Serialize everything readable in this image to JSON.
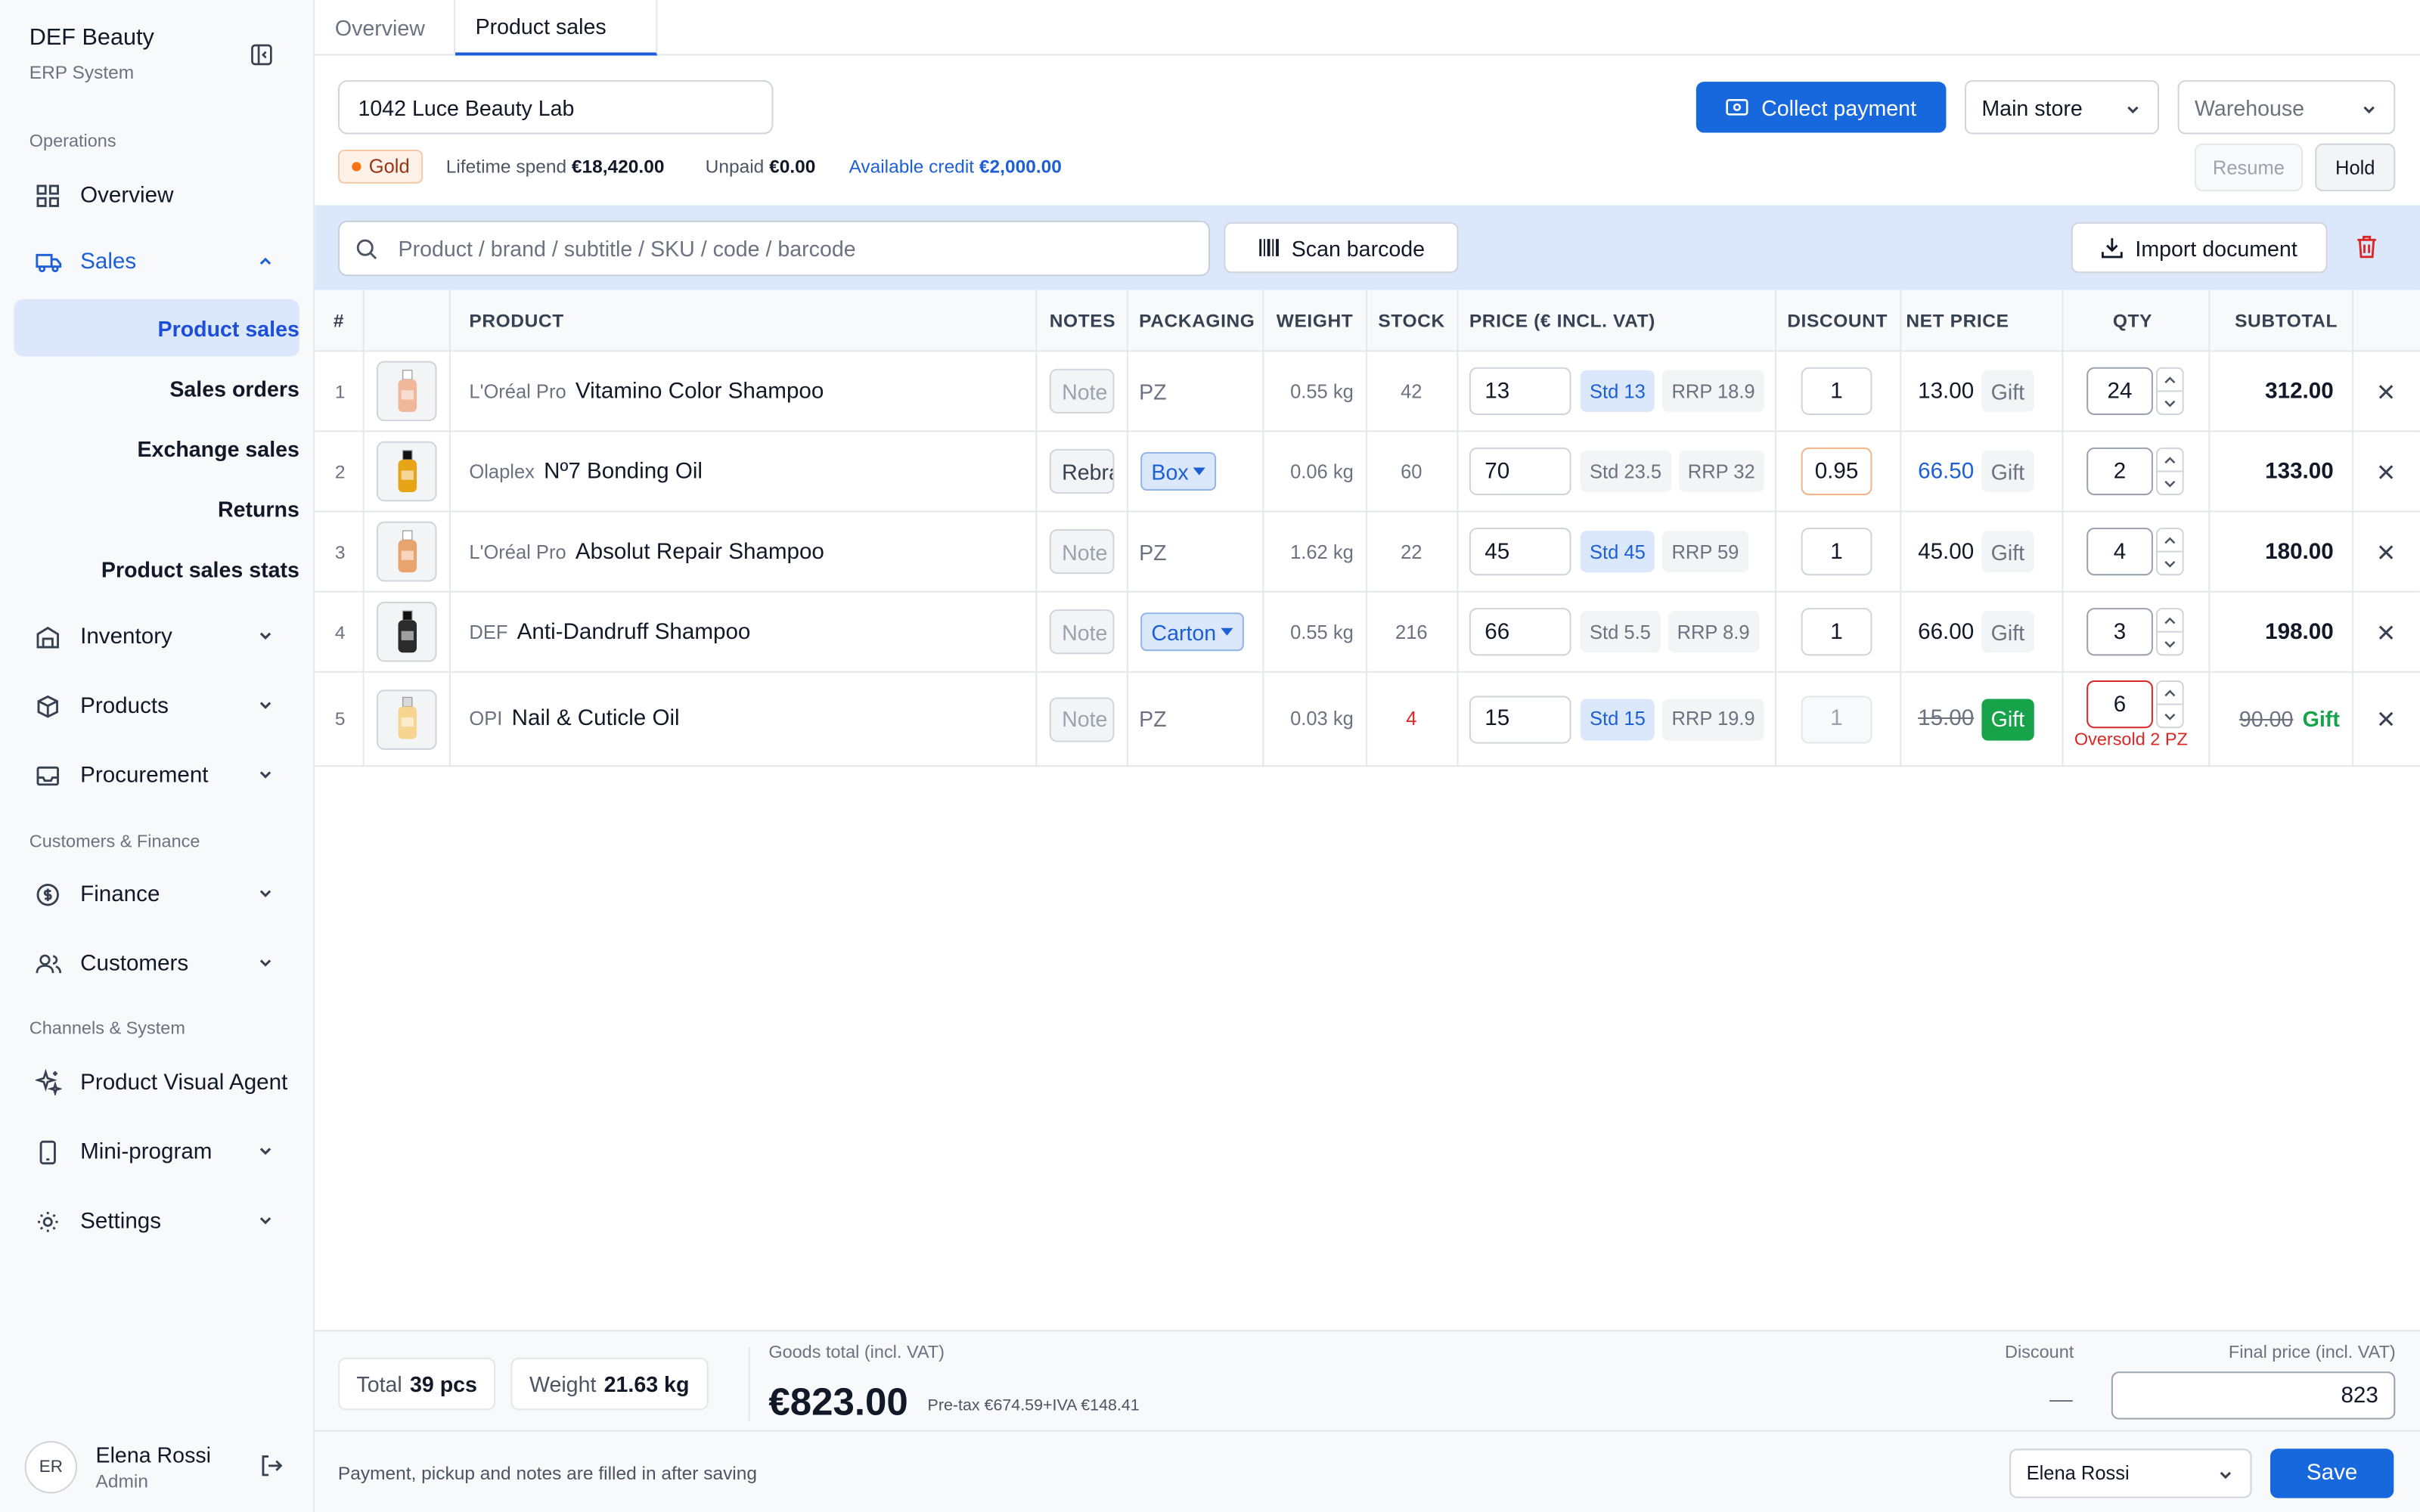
{
  "brand": {
    "title": "DEF Beauty",
    "subtitle": "ERP System"
  },
  "sidebar": {
    "sec_operations": "Operations",
    "overview": "Overview",
    "sales": "Sales",
    "sales_sub": [
      "Product sales",
      "Sales orders",
      "Exchange sales",
      "Returns",
      "Product sales stats"
    ],
    "inventory": "Inventory",
    "products": "Products",
    "procurement": "Procurement",
    "sec_customers": "Customers & Finance",
    "finance": "Finance",
    "customers": "Customers",
    "sec_channels": "Channels & System",
    "visual_agent": "Product Visual Agent",
    "mini_program": "Mini-program",
    "settings": "Settings"
  },
  "user": {
    "initials": "ER",
    "name": "Elena Rossi",
    "role": "Admin"
  },
  "tabs": [
    "Overview",
    "Product sales"
  ],
  "header": {
    "customer": "1042 Luce Beauty Lab",
    "collect_payment": "Collect payment",
    "store": "Main store",
    "warehouse_placeholder": "Warehouse",
    "resume": "Resume",
    "hold": "Hold",
    "tier": "Gold",
    "lifetime_label": "Lifetime spend",
    "lifetime_value": "€18,420.00",
    "unpaid_label": "Unpaid",
    "unpaid_value": "€0.00",
    "credit_label": "Available credit",
    "credit_value": "€2,000.00"
  },
  "toolbar": {
    "search_placeholder": "Product / brand / subtitle / SKU / code / barcode",
    "scan": "Scan barcode",
    "import": "Import document"
  },
  "columns": [
    "#",
    "PRODUCT",
    "NOTES",
    "PACKAGING",
    "WEIGHT",
    "STOCK",
    "PRICE (€ INCL. VAT)",
    "DISCOUNT",
    "NET PRICE",
    "QTY",
    "SUBTOTAL"
  ],
  "rows": [
    {
      "n": "1",
      "brand": "L'Oréal Pro",
      "name": "Vitamino Color Shampoo",
      "note": "Note",
      "note_filled": false,
      "pkg": "PZ",
      "pkg_sel": false,
      "weight": "0.55 kg",
      "stock": "42",
      "stock_low": false,
      "price": "13",
      "std": "Std 13",
      "std_on": true,
      "rrp": "RRP 18.9",
      "discount": "1",
      "disc_state": "normal",
      "net": "13.00",
      "net_state": "normal",
      "gift": "Gift",
      "gift_on": false,
      "qty": "24",
      "qty_err": false,
      "oversold": "",
      "subtotal": "312.00",
      "sub_strike": false,
      "bottle": "#f0b79a",
      "cap": "#ffffff"
    },
    {
      "n": "2",
      "brand": "Olaplex",
      "name": "Nº7 Bonding Oil",
      "note": "Rebrand",
      "note_filled": true,
      "pkg": "Box",
      "pkg_sel": true,
      "weight": "0.06 kg",
      "stock": "60",
      "stock_low": false,
      "price": "70",
      "std": "Std 23.5",
      "std_on": false,
      "rrp": "RRP 32",
      "discount": "0.95",
      "disc_state": "warn",
      "net": "66.50",
      "net_state": "blue",
      "gift": "Gift",
      "gift_on": false,
      "qty": "2",
      "qty_err": false,
      "oversold": "",
      "subtotal": "133.00",
      "sub_strike": false,
      "bottle": "#e8a417",
      "cap": "#111111"
    },
    {
      "n": "3",
      "brand": "L'Oréal Pro",
      "name": "Absolut Repair Shampoo",
      "note": "Note",
      "note_filled": false,
      "pkg": "PZ",
      "pkg_sel": false,
      "weight": "1.62 kg",
      "stock": "22",
      "stock_low": false,
      "price": "45",
      "std": "Std 45",
      "std_on": true,
      "rrp": "RRP 59",
      "discount": "1",
      "disc_state": "normal",
      "net": "45.00",
      "net_state": "normal",
      "gift": "Gift",
      "gift_on": false,
      "qty": "4",
      "qty_err": false,
      "oversold": "",
      "subtotal": "180.00",
      "sub_strike": false,
      "bottle": "#e9a36c",
      "cap": "#ffffff"
    },
    {
      "n": "4",
      "brand": "DEF",
      "name": "Anti-Dandruff Shampoo",
      "note": "Note",
      "note_filled": false,
      "pkg": "Carton",
      "pkg_sel": true,
      "weight": "0.55 kg",
      "stock": "216",
      "stock_low": false,
      "price": "66",
      "std": "Std 5.5",
      "std_on": false,
      "rrp": "RRP 8.9",
      "discount": "1",
      "disc_state": "normal",
      "net": "66.00",
      "net_state": "normal",
      "gift": "Gift",
      "gift_on": false,
      "qty": "3",
      "qty_err": false,
      "oversold": "",
      "subtotal": "198.00",
      "sub_strike": false,
      "bottle": "#2b2b2b",
      "cap": "#111111"
    },
    {
      "n": "5",
      "brand": "OPI",
      "name": "Nail & Cuticle Oil",
      "note": "Note",
      "note_filled": false,
      "pkg": "PZ",
      "pkg_sel": false,
      "weight": "0.03 kg",
      "stock": "4",
      "stock_low": true,
      "price": "15",
      "std": "Std 15",
      "std_on": true,
      "rrp": "RRP 19.9",
      "discount": "1",
      "disc_state": "disabled",
      "net": "15.00",
      "net_state": "strike",
      "gift": "Gift",
      "gift_on": true,
      "qty": "6",
      "qty_err": true,
      "oversold": "Oversold 2 PZ",
      "subtotal": "90.00",
      "sub_strike": true,
      "bottle": "#f5d590",
      "cap": "#d9d9d9"
    }
  ],
  "footer": {
    "total_label": "Total",
    "total_value": "39 pcs",
    "weight_label": "Weight",
    "weight_value": "21.63 kg",
    "goods_label": "Goods total (incl. VAT)",
    "goods_total": "€823.00",
    "pretax": "Pre-tax €674.59+IVA €148.41",
    "discount_label": "Discount",
    "discount_value": "—",
    "final_label": "Final price (incl. VAT)",
    "final_value": "823",
    "note": "Payment, pickup and notes are filled in after saving",
    "salesperson": "Elena Rossi",
    "save": "Save"
  },
  "colors": {
    "primary": "#1668dc",
    "active_bg": "#dbe8fb",
    "danger": "#dc2626",
    "gift_green": "#16a34a"
  }
}
